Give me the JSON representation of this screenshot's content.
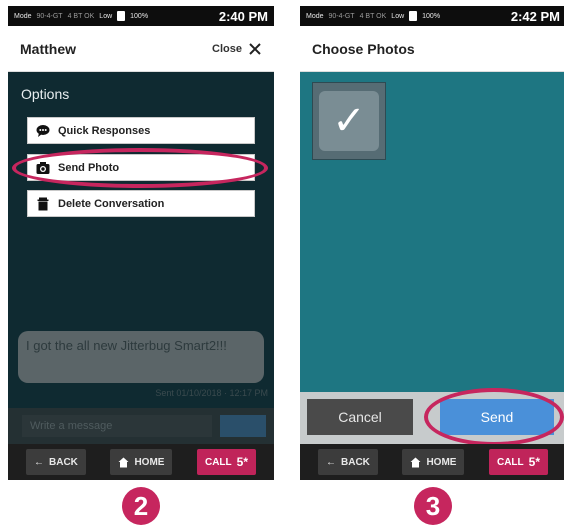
{
  "colors": {
    "accent_magenta": "#c6265e",
    "send_blue": "#4a90d9",
    "teal": "#1e7682",
    "dark_teal": "#0f2a31"
  },
  "phone1": {
    "status": {
      "mode": "Mode",
      "signal": "90-4-GT",
      "network": "4 BT OK",
      "vol": "Low",
      "battery": "100%",
      "time": "2:40 PM"
    },
    "header": {
      "title": "Matthew",
      "close_label": "Close"
    },
    "options_label": "Options",
    "options": [
      {
        "label": "Quick Responses",
        "icon": "chat-bubble-icon"
      },
      {
        "label": "Send Photo",
        "icon": "camera-icon"
      },
      {
        "label": "Delete Conversation",
        "icon": "trash-icon"
      }
    ],
    "message": {
      "text": "I got the all new Jitterbug Smart2!!!",
      "timestamp": "Sent 01/10/2018 · 12:17 PM"
    },
    "compose_placeholder": "Write a message",
    "nav": {
      "back": "BACK",
      "home": "HOME",
      "call": "CALL",
      "call_sup": "5*"
    },
    "step_number": "2"
  },
  "phone2": {
    "status": {
      "mode": "Mode",
      "signal": "90-4-GT",
      "network": "4 BT OK",
      "vol": "Low",
      "battery": "100%",
      "time": "2:42 PM"
    },
    "header": {
      "title": "Choose Photos"
    },
    "selected_photo_icon": "checkmark-icon",
    "actions": {
      "cancel": "Cancel",
      "send": "Send"
    },
    "nav": {
      "back": "BACK",
      "home": "HOME",
      "call": "CALL",
      "call_sup": "5*"
    },
    "step_number": "3"
  }
}
